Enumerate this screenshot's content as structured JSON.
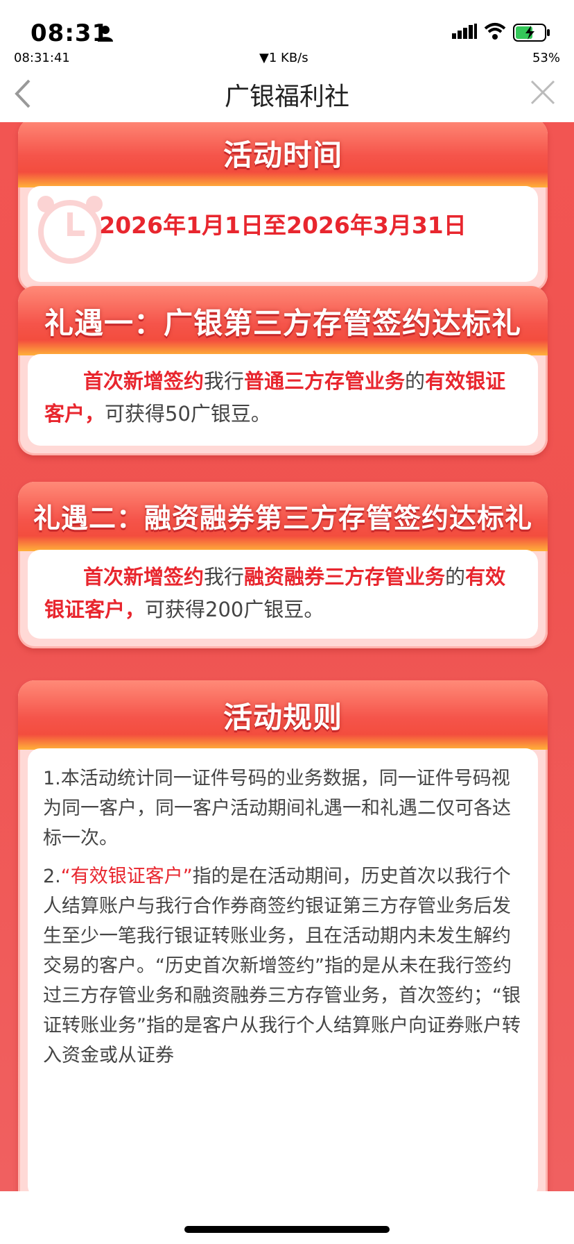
{
  "status_bar": {
    "time": "08:31",
    "clock": "08:31:41",
    "net_speed": "▼1 KB/s",
    "battery": "53%"
  },
  "nav": {
    "title": "广银福利社",
    "back_icon": "chevron-left-icon",
    "close_icon": "close-icon"
  },
  "period": {
    "heading": "活动时间",
    "dates": "2026年1月1日至2026年3月31日",
    "icon": "alarm-clock-icon"
  },
  "gift1": {
    "heading": "礼遇一：广银第三方存管签约达标礼",
    "p1": "首次新增签约",
    "p2": "我行",
    "p3": "普通三方存管业务",
    "p4": "的",
    "p5": "有效银证客户，",
    "p6": "可获得50广银豆。"
  },
  "gift2": {
    "heading": "礼遇二：融资融券第三方存管签约达标礼",
    "p1": "首次新增签约",
    "p2": "我行",
    "p3": "融资融券三方存管业务",
    "p4": "的",
    "p5": "有效银证客户，",
    "p6": "可获得200广银豆。"
  },
  "rules": {
    "heading": "活动规则",
    "r1": "1.本活动统计同一证件号码的业务数据，同一证件号码视为同一客户，同一客户活动期间礼遇一和礼遇二仅可各达标一次。",
    "r2_prefix": "2.",
    "r2_hl": "“有效银证客户”",
    "r2_rest": "指的是在活动期间，历史首次以我行个人结算账户与我行合作券商签约银证第三方存管业务后发生至少一笔我行银证转账业务，且在活动期内未发生解约交易的客户。“历史首次新增签约”指的是从未在我行签约过三方存管业务和融资融券三方存管业务，首次签约；“银证转账业务”指的是客户从我行个人结算账户向证券账户转入资金或从证券"
  },
  "colors": {
    "accent": "#e8262e",
    "background": "#ef5350"
  }
}
